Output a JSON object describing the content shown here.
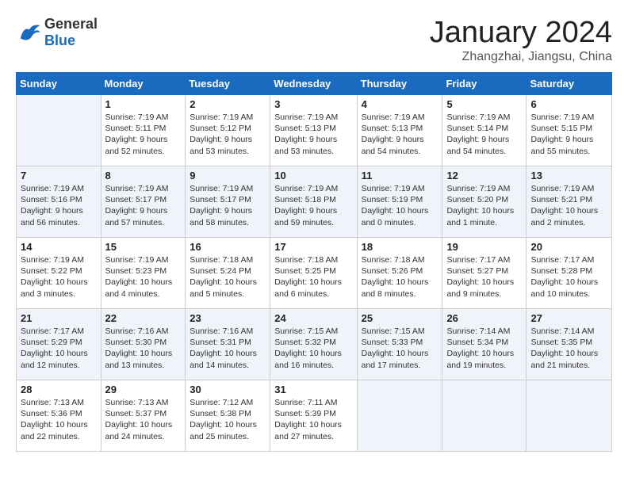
{
  "header": {
    "logo": {
      "line1": "General",
      "line2": "Blue"
    },
    "title": "January 2024",
    "subtitle": "Zhangzhai, Jiangsu, China"
  },
  "weekdays": [
    "Sunday",
    "Monday",
    "Tuesday",
    "Wednesday",
    "Thursday",
    "Friday",
    "Saturday"
  ],
  "weeks": [
    [
      {
        "day": "",
        "info": ""
      },
      {
        "day": "1",
        "info": "Sunrise: 7:19 AM\nSunset: 5:11 PM\nDaylight: 9 hours\nand 52 minutes."
      },
      {
        "day": "2",
        "info": "Sunrise: 7:19 AM\nSunset: 5:12 PM\nDaylight: 9 hours\nand 53 minutes."
      },
      {
        "day": "3",
        "info": "Sunrise: 7:19 AM\nSunset: 5:13 PM\nDaylight: 9 hours\nand 53 minutes."
      },
      {
        "day": "4",
        "info": "Sunrise: 7:19 AM\nSunset: 5:13 PM\nDaylight: 9 hours\nand 54 minutes."
      },
      {
        "day": "5",
        "info": "Sunrise: 7:19 AM\nSunset: 5:14 PM\nDaylight: 9 hours\nand 54 minutes."
      },
      {
        "day": "6",
        "info": "Sunrise: 7:19 AM\nSunset: 5:15 PM\nDaylight: 9 hours\nand 55 minutes."
      }
    ],
    [
      {
        "day": "7",
        "info": "Sunrise: 7:19 AM\nSunset: 5:16 PM\nDaylight: 9 hours\nand 56 minutes."
      },
      {
        "day": "8",
        "info": "Sunrise: 7:19 AM\nSunset: 5:17 PM\nDaylight: 9 hours\nand 57 minutes."
      },
      {
        "day": "9",
        "info": "Sunrise: 7:19 AM\nSunset: 5:17 PM\nDaylight: 9 hours\nand 58 minutes."
      },
      {
        "day": "10",
        "info": "Sunrise: 7:19 AM\nSunset: 5:18 PM\nDaylight: 9 hours\nand 59 minutes."
      },
      {
        "day": "11",
        "info": "Sunrise: 7:19 AM\nSunset: 5:19 PM\nDaylight: 10 hours\nand 0 minutes."
      },
      {
        "day": "12",
        "info": "Sunrise: 7:19 AM\nSunset: 5:20 PM\nDaylight: 10 hours\nand 1 minute."
      },
      {
        "day": "13",
        "info": "Sunrise: 7:19 AM\nSunset: 5:21 PM\nDaylight: 10 hours\nand 2 minutes."
      }
    ],
    [
      {
        "day": "14",
        "info": "Sunrise: 7:19 AM\nSunset: 5:22 PM\nDaylight: 10 hours\nand 3 minutes."
      },
      {
        "day": "15",
        "info": "Sunrise: 7:19 AM\nSunset: 5:23 PM\nDaylight: 10 hours\nand 4 minutes."
      },
      {
        "day": "16",
        "info": "Sunrise: 7:18 AM\nSunset: 5:24 PM\nDaylight: 10 hours\nand 5 minutes."
      },
      {
        "day": "17",
        "info": "Sunrise: 7:18 AM\nSunset: 5:25 PM\nDaylight: 10 hours\nand 6 minutes."
      },
      {
        "day": "18",
        "info": "Sunrise: 7:18 AM\nSunset: 5:26 PM\nDaylight: 10 hours\nand 8 minutes."
      },
      {
        "day": "19",
        "info": "Sunrise: 7:17 AM\nSunset: 5:27 PM\nDaylight: 10 hours\nand 9 minutes."
      },
      {
        "day": "20",
        "info": "Sunrise: 7:17 AM\nSunset: 5:28 PM\nDaylight: 10 hours\nand 10 minutes."
      }
    ],
    [
      {
        "day": "21",
        "info": "Sunrise: 7:17 AM\nSunset: 5:29 PM\nDaylight: 10 hours\nand 12 minutes."
      },
      {
        "day": "22",
        "info": "Sunrise: 7:16 AM\nSunset: 5:30 PM\nDaylight: 10 hours\nand 13 minutes."
      },
      {
        "day": "23",
        "info": "Sunrise: 7:16 AM\nSunset: 5:31 PM\nDaylight: 10 hours\nand 14 minutes."
      },
      {
        "day": "24",
        "info": "Sunrise: 7:15 AM\nSunset: 5:32 PM\nDaylight: 10 hours\nand 16 minutes."
      },
      {
        "day": "25",
        "info": "Sunrise: 7:15 AM\nSunset: 5:33 PM\nDaylight: 10 hours\nand 17 minutes."
      },
      {
        "day": "26",
        "info": "Sunrise: 7:14 AM\nSunset: 5:34 PM\nDaylight: 10 hours\nand 19 minutes."
      },
      {
        "day": "27",
        "info": "Sunrise: 7:14 AM\nSunset: 5:35 PM\nDaylight: 10 hours\nand 21 minutes."
      }
    ],
    [
      {
        "day": "28",
        "info": "Sunrise: 7:13 AM\nSunset: 5:36 PM\nDaylight: 10 hours\nand 22 minutes."
      },
      {
        "day": "29",
        "info": "Sunrise: 7:13 AM\nSunset: 5:37 PM\nDaylight: 10 hours\nand 24 minutes."
      },
      {
        "day": "30",
        "info": "Sunrise: 7:12 AM\nSunset: 5:38 PM\nDaylight: 10 hours\nand 25 minutes."
      },
      {
        "day": "31",
        "info": "Sunrise: 7:11 AM\nSunset: 5:39 PM\nDaylight: 10 hours\nand 27 minutes."
      },
      {
        "day": "",
        "info": ""
      },
      {
        "day": "",
        "info": ""
      },
      {
        "day": "",
        "info": ""
      }
    ]
  ]
}
